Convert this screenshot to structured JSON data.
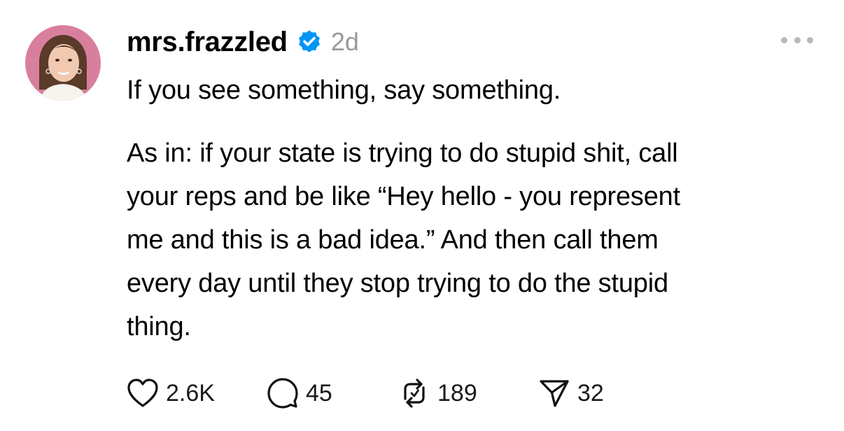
{
  "post": {
    "username": "mrs.frazzled",
    "time": "2d",
    "text_line1": "If you see something, say something.",
    "text_para2": [
      "As in: if your state is trying to do stupid shit, call",
      "your reps and be like “Hey hello - you represent",
      "me and this is a bad idea.” And then call them",
      "every day until they stop trying to do the stupid",
      "thing."
    ],
    "actions": {
      "likes": "2.6K",
      "comments": "45",
      "reposts": "189",
      "shares": "32"
    }
  },
  "colors": {
    "verified_badge": "#0095f6",
    "muted_text": "#9a9a9a",
    "avatar_background": "#d97f9e"
  },
  "icons": {
    "verified": "verified-badge-icon",
    "more": "more-options-icon",
    "like": "heart-icon",
    "comment": "comment-bubble-icon",
    "repost": "repost-icon",
    "share": "send-icon"
  }
}
